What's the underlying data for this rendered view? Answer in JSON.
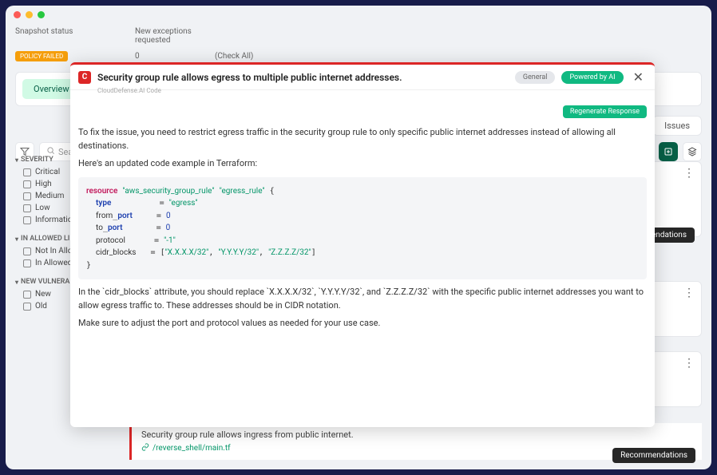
{
  "bg": {
    "header_col1": "Snapshot status",
    "header_col2": "New exceptions requested",
    "row_val1": "0",
    "row_val2": "(Check All)",
    "policy_badge": "POLICY FAILED",
    "overview_label": "Overview",
    "tab_issues": "Issues",
    "search_placeholder": "Sea"
  },
  "sidebar": {
    "groups": [
      {
        "title": "SEVERITY",
        "items": [
          "Critical",
          "High",
          "Medium",
          "Low",
          "Informational"
        ]
      },
      {
        "title": "IN ALLOWED LI",
        "items": [
          "Not In Allowed",
          "In Allowed Lis"
        ]
      },
      {
        "title": "NEW VULNERA",
        "items": [
          "New",
          "Old"
        ]
      }
    ]
  },
  "cards": {
    "recommendations_label": "ommendations",
    "recommendations_label_full": "Recommendations"
  },
  "finding": {
    "text": "Security group rule allows ingress from public internet.",
    "link": "/reverse_shell/main.tf"
  },
  "modal": {
    "title": "Security group rule allows egress to multiple public internet addresses.",
    "subtitle": "CloudDefense.AI Code",
    "pill_general": "General",
    "pill_powered": "Powered by AI",
    "regen": "Regenerate Response",
    "para1": "To fix the issue, you need to restrict egress traffic in the security group rule to only specific public internet addresses instead of allowing all destinations.",
    "para2": "Here's an updated code example in Terraform:",
    "code": {
      "kw_resource": "resource",
      "res_type": "\"aws_security_group_rule\"",
      "res_name": "\"egress_rule\"",
      "attr_type": "type",
      "val_type": "\"egress\"",
      "attr_from": "from_port",
      "val_from": "0",
      "attr_to": "to_port",
      "val_to": "0",
      "attr_proto": "protocol",
      "val_proto": "\"-1\"",
      "attr_cidr": "cidr_blocks",
      "cidr1": "\"X.X.X.X/32\"",
      "cidr2": "\"Y.Y.Y.Y/32\"",
      "cidr3": "\"Z.Z.Z.Z/32\""
    },
    "para3": "In the `cidr_blocks` attribute, you should replace `X.X.X.X/32`, `Y.Y.Y.Y/32`, and `Z.Z.Z.Z/32` with the specific public internet addresses you want to allow egress traffic to. These addresses should be in CIDR notation.",
    "para4": "Make sure to adjust the port and protocol values as needed for your use case."
  }
}
